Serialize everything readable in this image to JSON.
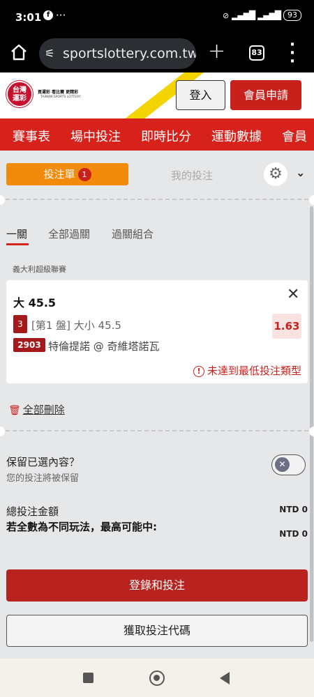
{
  "statusbar": {
    "time": "3:01",
    "dots": "···",
    "battery": "93"
  },
  "browser": {
    "url": "sportslottery.com.tw/s",
    "tab_count": "83"
  },
  "site": {
    "logo_name": "台灣運彩",
    "tagline": "買運彩 看比賽 更精彩",
    "tagline_en": "TAIWAN SPORTS LOTTERY",
    "login": "登入",
    "signup": "會員申請"
  },
  "nav": {
    "items": [
      "賽事表",
      "場中投注",
      "即時比分",
      "運動數據",
      "會員"
    ]
  },
  "tabs": {
    "betslip": "投注單",
    "betslip_count": "1",
    "mybets": "我的投注"
  },
  "bettypes": {
    "single": "一關",
    "all_parlay": "全部過關",
    "parlay_combo": "過關組合"
  },
  "bet": {
    "league": "義大利超級聯賽",
    "selection": "大 45.5",
    "market_badge": "3",
    "market": "[第1 盤] 大小 45.5",
    "odds": "1.63",
    "game_no": "2903",
    "match": "特倫提諾 @ 奇維塔諾瓦",
    "warning": "未達到最低投注類型"
  },
  "actions": {
    "delete_all": "全部刪除"
  },
  "keep": {
    "title": "保留已選內容？",
    "subtitle": "您的投注將被保留"
  },
  "summary": {
    "total_label": "總投注金額",
    "total_value": "NTD 0",
    "maxwin_label": "若全數為不同玩法，最高可能中:",
    "maxwin_value": "NTD 0"
  },
  "buttons": {
    "login_and_bet": "登錄和投注",
    "get_code": "獲取投注代碼"
  },
  "colors": {
    "brand_red": "#d7221c",
    "orange": "#f28b0c",
    "yellow": "#f3d300"
  }
}
